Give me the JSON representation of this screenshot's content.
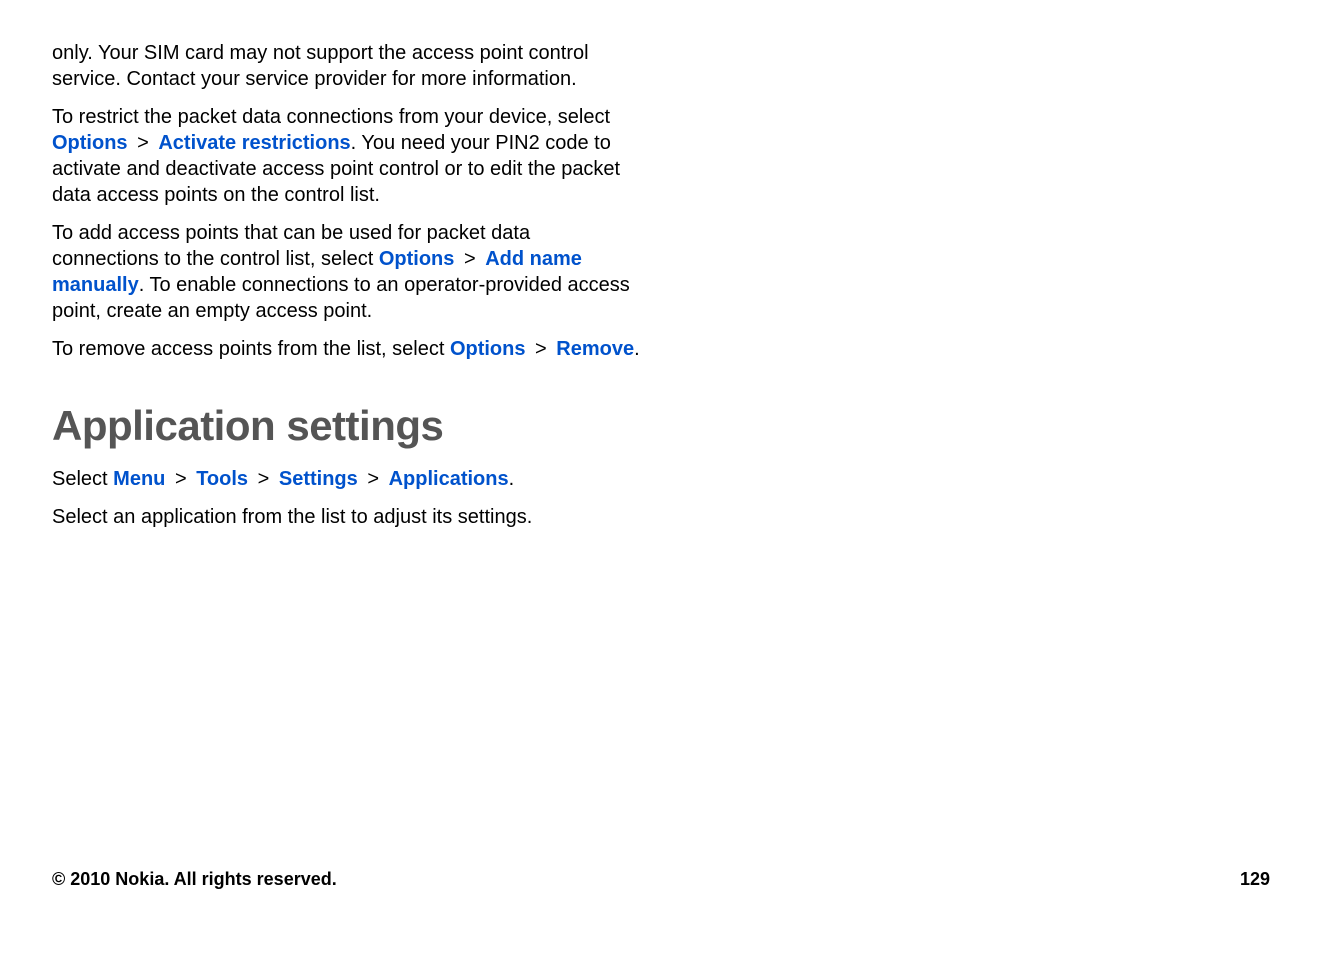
{
  "paragraphs": {
    "p1": "only. Your SIM card may not support the access point control service. Contact your service provider for more information.",
    "p2_before": "To restrict the packet data connections from your device, select ",
    "p2_link1": "Options",
    "p2_sep1": ">",
    "p2_link2": "Activate restrictions",
    "p2_after": ". You need your PIN2 code to activate and deactivate access point control or to edit the packet data access points on the control list.",
    "p3_before": "To add access points that can be used for packet data connections to the control list, select ",
    "p3_link1": "Options",
    "p3_sep1": ">",
    "p3_link2": "Add name manually",
    "p3_after": ". To enable connections to an operator-provided access point, create an empty access point.",
    "p4_before": "To remove access points from the list, select ",
    "p4_link1": "Options",
    "p4_sep1": ">",
    "p4_link2": "Remove",
    "p4_after": "."
  },
  "heading": "Application settings",
  "nav": {
    "before": "Select ",
    "menu": "Menu",
    "sep1": ">",
    "tools": "Tools",
    "sep2": ">",
    "settings": "Settings",
    "sep3": ">",
    "applications": "Applications",
    "after": "."
  },
  "p5": "Select an application from the list to adjust its settings.",
  "footer": {
    "copyright": "© 2010 Nokia. All rights reserved.",
    "page": "129"
  }
}
